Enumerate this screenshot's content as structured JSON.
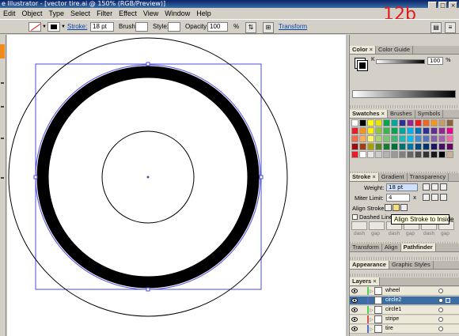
{
  "window": {
    "title": "e Illustrator - [vector tire.ai @ 150% (RGB/Preview)]",
    "buttons": [
      "_",
      "□",
      "×"
    ]
  },
  "annotation": "12b",
  "menu": [
    "Edit",
    "Object",
    "Type",
    "Select",
    "Filter",
    "Effect",
    "View",
    "Window",
    "Help"
  ],
  "control_bar": {
    "stroke_label": "Stroke:",
    "stroke_weight": "18 pt",
    "brush_label": "Brush:",
    "style_label": "Style:",
    "opacity_label": "Opacity:",
    "opacity_value": "100",
    "opacity_unit": "%",
    "transform_label": "Transform"
  },
  "color_panel": {
    "tabs": [
      "Color",
      "Color Guide"
    ],
    "k_label": "K",
    "k_value": "100",
    "k_unit": "%"
  },
  "swatches_panel": {
    "tabs": [
      "Swatches",
      "Brushes",
      "Symbols"
    ],
    "colors": [
      "#ffffff",
      "#000000",
      "#ffff00",
      "#e6e600",
      "#00a651",
      "#00a99d",
      "#2e3192",
      "#92278f",
      "#ed1c24",
      "#f26522",
      "#f7941d",
      "#c69c6d",
      "#8c6239",
      "#ed1c24",
      "#f7941d",
      "#fff200",
      "#8dc63f",
      "#39b54a",
      "#00a651",
      "#00a99d",
      "#00aeef",
      "#0072bc",
      "#2e3192",
      "#662d91",
      "#92278f",
      "#ec008c",
      "#f26c4f",
      "#fbaf5d",
      "#fff568",
      "#acd373",
      "#7cc576",
      "#3bb878",
      "#1abbb4",
      "#00bff3",
      "#448ccb",
      "#5674b9",
      "#8560a8",
      "#a864a8",
      "#f06eaa",
      "#9e0b0f",
      "#a0410d",
      "#aba000",
      "#598527",
      "#197b30",
      "#007236",
      "#00746b",
      "#0076a3",
      "#004a80",
      "#003471",
      "#1b1464",
      "#440e62",
      "#630460",
      "#ed1c24",
      "#ffffff",
      "#e6e6e6",
      "#cccccc",
      "#b3b3b3",
      "#999999",
      "#808080",
      "#666666",
      "#4d4d4d",
      "#333333",
      "#1a1a1a",
      "#000000",
      "#c7b299"
    ]
  },
  "stroke_panel": {
    "tabs": [
      "Stroke",
      "Gradient",
      "Transparency"
    ],
    "weight_label": "Weight:",
    "weight_value": "18 pt",
    "miter_label": "Miter Limit:",
    "miter_value": "4",
    "miter_unit": "x",
    "align_label": "Align Stroke:",
    "dashed_label": "Dashed Line",
    "dash_fields": [
      "dash",
      "gap",
      "dash",
      "gap",
      "dash",
      "gap"
    ],
    "tooltip": "Align Stroke to Inside"
  },
  "transform_panel": {
    "tabs": [
      "Transform",
      "Align",
      "Pathfinder"
    ]
  },
  "appearance_panel": {
    "tabs": [
      "Appearance",
      "Graphic Styles"
    ]
  },
  "layers_panel": {
    "tabs": [
      "Layers"
    ],
    "rows": [
      {
        "name": "wheel",
        "selected": false,
        "color": "#4fd34f"
      },
      {
        "name": "circle2",
        "selected": true,
        "color": "#4f6cd3"
      },
      {
        "name": "circle1",
        "selected": false,
        "color": "#4fd34f"
      },
      {
        "name": "stripe",
        "selected": false,
        "color": "#d34f4f"
      },
      {
        "name": "tire",
        "selected": false,
        "color": "#4f6cd3"
      }
    ]
  }
}
